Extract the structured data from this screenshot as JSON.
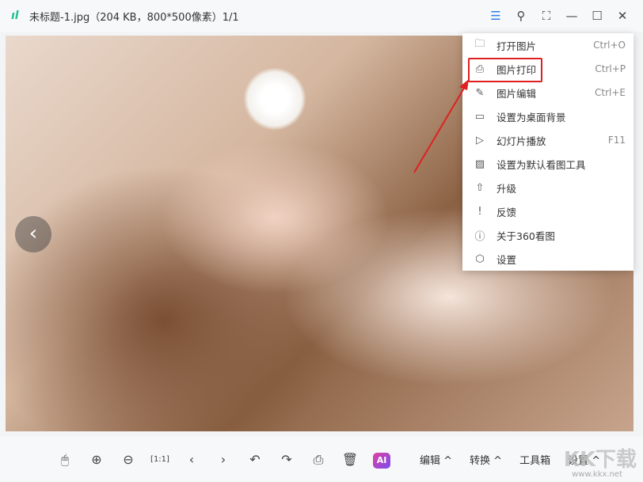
{
  "title": "未标题-1.jpg（204 KB，800*500像素）1/1",
  "menu": [
    {
      "label": "打开图片",
      "shortcut": "Ctrl+O",
      "icon": "folder-icon",
      "g": "🗀"
    },
    {
      "label": "图片打印",
      "shortcut": "Ctrl+P",
      "icon": "printer-icon",
      "g": "⎙"
    },
    {
      "label": "图片编辑",
      "shortcut": "Ctrl+E",
      "icon": "edit-icon",
      "g": "✎"
    },
    {
      "label": "设置为桌面背景",
      "shortcut": "",
      "icon": "wallpaper-icon",
      "g": "▭"
    },
    {
      "label": "幻灯片播放",
      "shortcut": "F11",
      "icon": "slideshow-icon",
      "g": "▷"
    },
    {
      "label": "设置为默认看图工具",
      "shortcut": "",
      "icon": "image-icon",
      "g": "▨"
    },
    {
      "label": "升级",
      "shortcut": "",
      "icon": "upgrade-icon",
      "g": "⇧"
    },
    {
      "label": "反馈",
      "shortcut": "",
      "icon": "feedback-icon",
      "g": "!"
    },
    {
      "label": "关于360看图",
      "shortcut": "",
      "icon": "info-icon",
      "g": "ⓘ"
    },
    {
      "label": "设置",
      "shortcut": "",
      "icon": "settings-icon",
      "g": "⬡"
    }
  ],
  "bottom": {
    "edit": "编辑 ^",
    "convert": "转换 ^",
    "toolbox": "工具箱",
    "settings": "设置 ^",
    "ai": "AI"
  },
  "watermark": "KK下载",
  "watermark_url": "www.kkx.net"
}
